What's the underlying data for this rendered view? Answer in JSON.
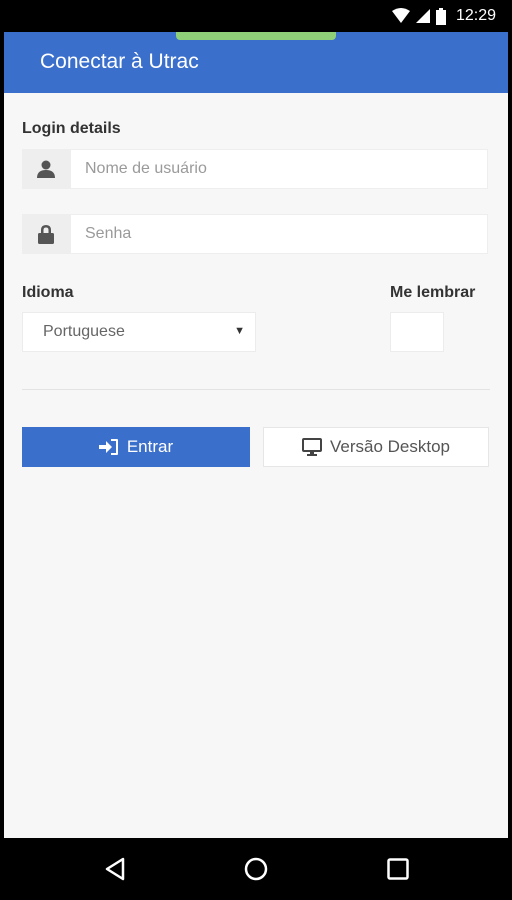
{
  "status_bar": {
    "time": "12:29"
  },
  "app_bar": {
    "title": "Conectar à Utrac"
  },
  "form": {
    "section_label": "Login details",
    "username_placeholder": "Nome de usuário",
    "password_placeholder": "Senha",
    "language_label": "Idioma",
    "language_value": "Portuguese",
    "remember_label": "Me lembrar",
    "remember_checked": false
  },
  "buttons": {
    "login_label": "Entrar",
    "desktop_label": "Versão Desktop"
  },
  "colors": {
    "primary": "#3b6fcc",
    "accent_strip": "#8ecf77",
    "background": "#f7f7f7"
  },
  "icons": [
    "wifi-icon",
    "signal-icon",
    "battery-icon",
    "user-icon",
    "lock-icon",
    "sign-in-icon",
    "desktop-icon",
    "back-icon",
    "home-icon",
    "recents-icon"
  ]
}
